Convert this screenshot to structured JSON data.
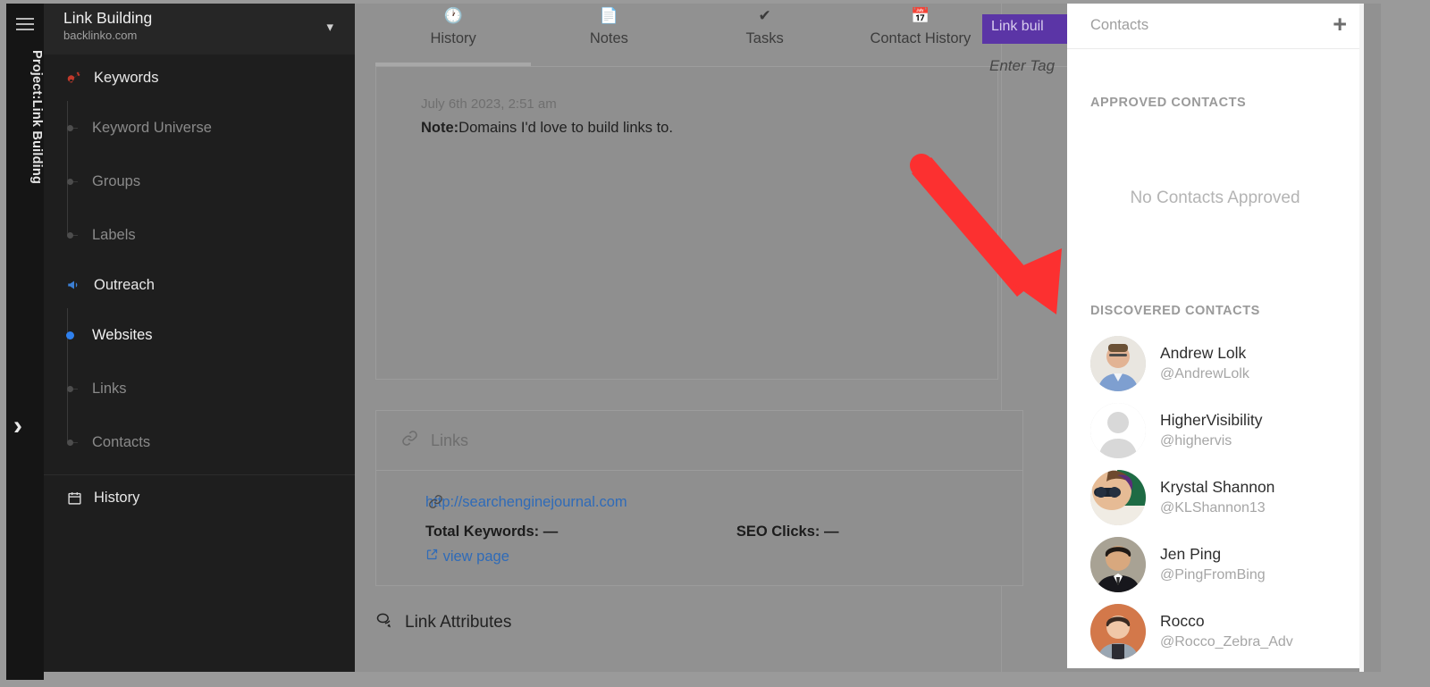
{
  "rail": {
    "hamburger_icon": "hamburger-icon",
    "project_label": "Project:Link Building",
    "expand_icon": "chevron-right-icon"
  },
  "sidebar": {
    "project_name": "Link Building",
    "project_domain": "backlinko.com",
    "collapse_icon": "chevron-down-icon",
    "groups": [
      {
        "label": "Keywords",
        "icon": "key-icon",
        "icon_color": "#c0392b",
        "items": [
          {
            "label": "Keyword Universe",
            "active": false
          },
          {
            "label": "Groups",
            "active": false
          },
          {
            "label": "Labels",
            "active": false
          }
        ]
      },
      {
        "label": "Outreach",
        "icon": "megaphone-icon",
        "icon_color": "#3b7fd4",
        "items": [
          {
            "label": "Websites",
            "active": true
          },
          {
            "label": "Links",
            "active": false
          },
          {
            "label": "Contacts",
            "active": false
          }
        ]
      }
    ],
    "history": {
      "label": "History",
      "icon": "calendar-icon"
    }
  },
  "main": {
    "tabs": [
      {
        "label": "History",
        "icon": "clock-icon",
        "active": true
      },
      {
        "label": "Notes",
        "icon": "document-icon",
        "active": false
      },
      {
        "label": "Tasks",
        "icon": "check-icon",
        "active": false
      },
      {
        "label": "Contact History",
        "icon": "calendar-icon",
        "active": false
      }
    ],
    "note": {
      "timestamp": "July 6th 2023, 2:51 am",
      "label": "Note:",
      "text": "Domains I'd love to build links to."
    },
    "tag_chip": "Link buil",
    "tag_placeholder": "Enter Tag",
    "links_card": {
      "header": "Links",
      "header_icon": "chain-icon",
      "url": "http://searchenginejournal.com",
      "total_keywords_label": "Total Keywords:",
      "total_keywords_value": "—",
      "seo_clicks_label": "SEO Clicks:",
      "seo_clicks_value": "—",
      "view_page": "view page",
      "view_page_icon": "external-link-icon"
    },
    "link_attributes": {
      "label": "Link Attributes",
      "icon": "comments-icon"
    }
  },
  "contacts_panel": {
    "title": "Contacts",
    "add_icon": "plus-icon",
    "approved_title": "APPROVED CONTACTS",
    "empty_message": "No Contacts Approved",
    "discovered_title": "DISCOVERED CONTACTS",
    "discovered": [
      {
        "name": "Andrew Lolk",
        "handle": "@AndrewLolk",
        "avatar": "photo-man-glasses-blue-shirt"
      },
      {
        "name": "HigherVisibility",
        "handle": "@highervis",
        "avatar": "default-silhouette"
      },
      {
        "name": "Krystal Shannon",
        "handle": "@KLShannon13",
        "avatar": "photo-woman-sunglasses"
      },
      {
        "name": "Jen Ping",
        "handle": "@PingFromBing",
        "avatar": "photo-man-suit"
      },
      {
        "name": "Rocco",
        "handle": "@Rocco_Zebra_Adv",
        "avatar": "photo-person-orange-bg"
      }
    ]
  },
  "annotation": {
    "arrow_color": "#fc3030",
    "arrow_direction": "down-right"
  },
  "colors": {
    "overlay_dim": "#919191",
    "sidebar_bg": "#1e1e1e",
    "rail_bg": "#151515",
    "accent_blue": "#2f80ed",
    "tag_purple": "#5b35a6",
    "link_blue": "#2f6bb8"
  }
}
